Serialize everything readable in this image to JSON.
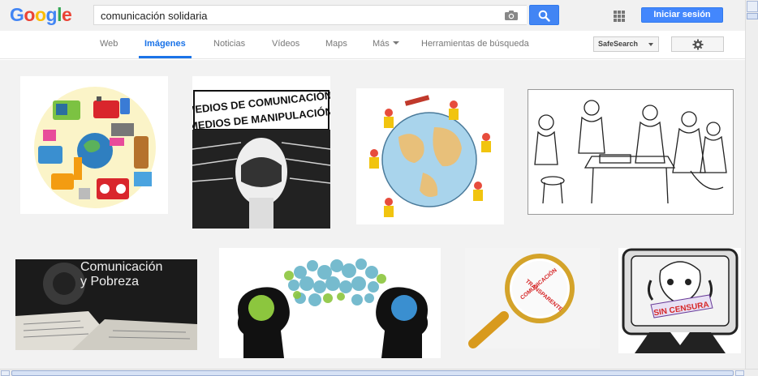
{
  "header": {
    "logo_letters": [
      {
        "char": "G",
        "color": "#4285f4"
      },
      {
        "char": "o",
        "color": "#ea4335"
      },
      {
        "char": "o",
        "color": "#fbbc05"
      },
      {
        "char": "g",
        "color": "#4285f4"
      },
      {
        "char": "l",
        "color": "#34a853"
      },
      {
        "char": "e",
        "color": "#ea4335"
      }
    ],
    "search_value": "comunicación solidaria",
    "signin_label": "Iniciar sesión"
  },
  "nav": {
    "tabs": [
      {
        "label": "Web",
        "active": false
      },
      {
        "label": "Imágenes",
        "active": true
      },
      {
        "label": "Noticias",
        "active": false
      },
      {
        "label": "Vídeos",
        "active": false
      },
      {
        "label": "Maps",
        "active": false
      },
      {
        "label": "Más",
        "active": false
      },
      {
        "label": "Herramientas de búsqueda",
        "active": false
      }
    ],
    "safesearch_label": "SafeSearch"
  },
  "results": {
    "images": [
      {
        "name": "image-communication-icons",
        "icon": "communication-devices-globe"
      },
      {
        "name": "image-medios-manipulacion",
        "icon": "medios-poster",
        "lines": [
          "MEDIOS DE COMUNICACIÓN!",
          "¿MEDIOS DE MANIPULACIÓN?"
        ]
      },
      {
        "name": "image-globe-children",
        "icon": "globe-with-children"
      },
      {
        "name": "image-community-drawing",
        "icon": "people-around-table"
      },
      {
        "name": "image-comunicacion-pobreza",
        "icon": "newspapers-photo",
        "lines": [
          "Comunicación",
          "y Pobreza"
        ]
      },
      {
        "name": "image-heads-speech-bubble",
        "icon": "two-heads-dialogue"
      },
      {
        "name": "image-magnifying-glass",
        "icon": "magnifying-glass",
        "lines": [
          "COMUNICACIÓN",
          "TRANSPARENTE"
        ]
      },
      {
        "name": "image-sin-censura",
        "icon": "tv-censorship",
        "lines": [
          "SIN CENSURA"
        ]
      }
    ]
  },
  "colors": {
    "accent": "#1a73e8",
    "button_blue": "#4285f4",
    "results_bg": "#f2f2f2"
  }
}
